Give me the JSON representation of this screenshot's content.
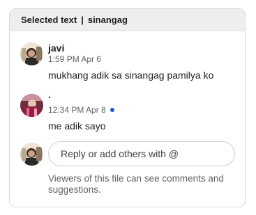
{
  "header": {
    "label": "Selected text",
    "separator": "|",
    "quote": "sinangag"
  },
  "comments": [
    {
      "author": "javi",
      "time": "1:59 PM Apr 6",
      "text": "mukhang adik sa sinangag pamilya ko",
      "avatar_icon": "user-photo-avatar"
    },
    {
      "author": ".",
      "time": "12:34 PM Apr 8",
      "text": "me adik sayo",
      "unread": true,
      "avatar_icon": "user-photo-avatar"
    }
  ],
  "reply": {
    "placeholder": "Reply or add others with @"
  },
  "footer_note": "Viewers of this file can see comments and suggestions.",
  "colors": {
    "unread_dot": "#1a56d6",
    "header_bg": "#eeeeee"
  }
}
